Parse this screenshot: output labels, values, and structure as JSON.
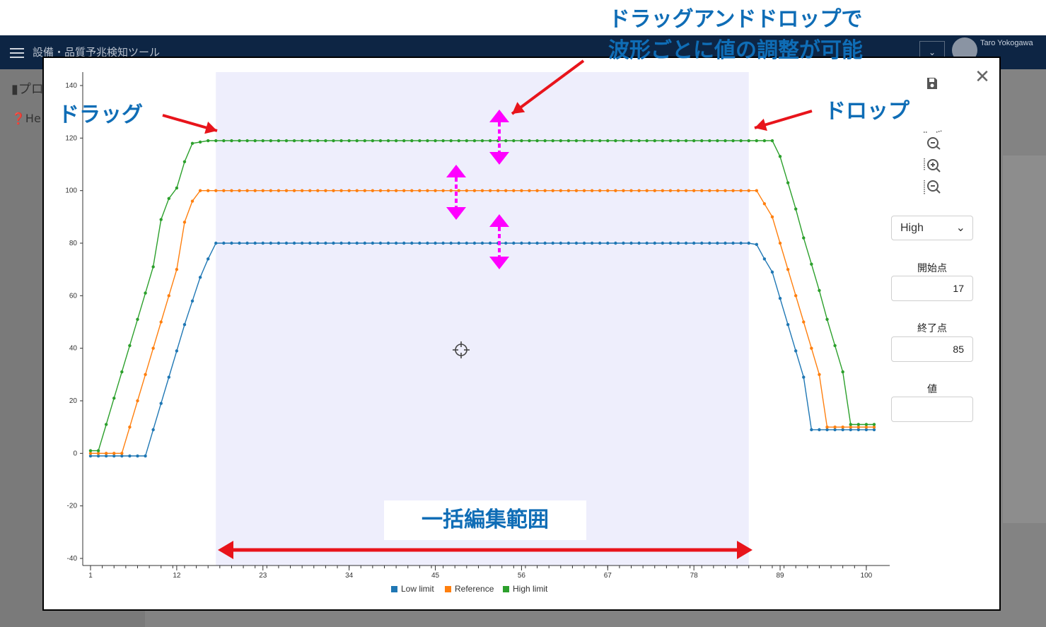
{
  "app": {
    "title": "設備・品質予兆検知ツール",
    "user": "Taro Yokogawa",
    "page_heading": "プロ",
    "help_label": "He"
  },
  "modal": {
    "series_select": "High",
    "start_label": "開始点",
    "start_value": "17",
    "end_label": "終了点",
    "end_value": "85",
    "value_label": "値",
    "value_value": ""
  },
  "annotations": {
    "top_line1": "ドラッグアンドドロップで",
    "top_line2": "波形ごとに値の調整が可能",
    "drag": "ドラッグ",
    "drop": "ドロップ",
    "batch": "一括編集範囲"
  },
  "colors": {
    "low": "#1f77b4",
    "reference": "#ff7f0e",
    "high": "#2ca02c",
    "annotation_text": "#0f6db6",
    "arrow_red": "#e8141b",
    "arrow_magenta": "#ff00ff",
    "selection": "#eeeefc"
  },
  "chart_data": {
    "type": "line",
    "x_range": [
      1,
      101
    ],
    "ylim": [
      -40,
      140
    ],
    "y_ticks": [
      140,
      120,
      100,
      80,
      60,
      40,
      20,
      0,
      -20,
      -40
    ],
    "x_ticks": [
      1,
      12,
      23,
      34,
      45,
      56,
      67,
      78,
      89,
      100
    ],
    "selection_range": [
      17,
      85
    ],
    "series": [
      {
        "name": "Low limit",
        "values": [
          [
            1,
            -1
          ],
          [
            8,
            -1
          ],
          [
            9,
            9
          ],
          [
            10,
            19
          ],
          [
            11,
            29
          ],
          [
            12,
            39
          ],
          [
            13,
            49
          ],
          [
            14,
            58
          ],
          [
            15,
            67
          ],
          [
            16,
            74
          ],
          [
            17,
            80
          ],
          [
            85,
            80
          ],
          [
            86,
            79.5
          ],
          [
            87,
            74
          ],
          [
            88,
            69
          ],
          [
            89,
            59
          ],
          [
            90,
            49
          ],
          [
            91,
            39
          ],
          [
            92,
            29
          ],
          [
            93,
            9
          ],
          [
            101,
            9
          ]
        ]
      },
      {
        "name": "Reference",
        "values": [
          [
            1,
            0
          ],
          [
            5,
            0
          ],
          [
            6,
            10
          ],
          [
            7,
            20
          ],
          [
            8,
            30
          ],
          [
            9,
            40
          ],
          [
            10,
            50
          ],
          [
            11,
            60
          ],
          [
            12,
            70
          ],
          [
            13,
            88
          ],
          [
            14,
            96
          ],
          [
            15,
            100
          ],
          [
            86,
            100
          ],
          [
            87,
            95
          ],
          [
            88,
            90
          ],
          [
            89,
            80
          ],
          [
            90,
            70
          ],
          [
            91,
            60
          ],
          [
            92,
            50
          ],
          [
            93,
            40
          ],
          [
            94,
            30
          ],
          [
            95,
            10
          ],
          [
            101,
            10
          ]
        ]
      },
      {
        "name": "High limit",
        "values": [
          [
            1,
            1
          ],
          [
            2,
            1
          ],
          [
            3,
            11
          ],
          [
            4,
            21
          ],
          [
            5,
            31
          ],
          [
            6,
            41
          ],
          [
            7,
            51
          ],
          [
            8,
            61
          ],
          [
            9,
            71
          ],
          [
            10,
            89
          ],
          [
            11,
            97
          ],
          [
            12,
            101
          ],
          [
            13,
            111
          ],
          [
            14,
            118
          ],
          [
            15,
            118.5
          ],
          [
            16,
            119
          ],
          [
            88,
            119
          ],
          [
            89,
            113
          ],
          [
            90,
            103
          ],
          [
            91,
            93
          ],
          [
            92,
            82
          ],
          [
            93,
            72
          ],
          [
            94,
            62
          ],
          [
            95,
            51
          ],
          [
            96,
            41
          ],
          [
            97,
            31
          ],
          [
            98,
            11
          ],
          [
            101,
            11
          ]
        ]
      }
    ]
  }
}
